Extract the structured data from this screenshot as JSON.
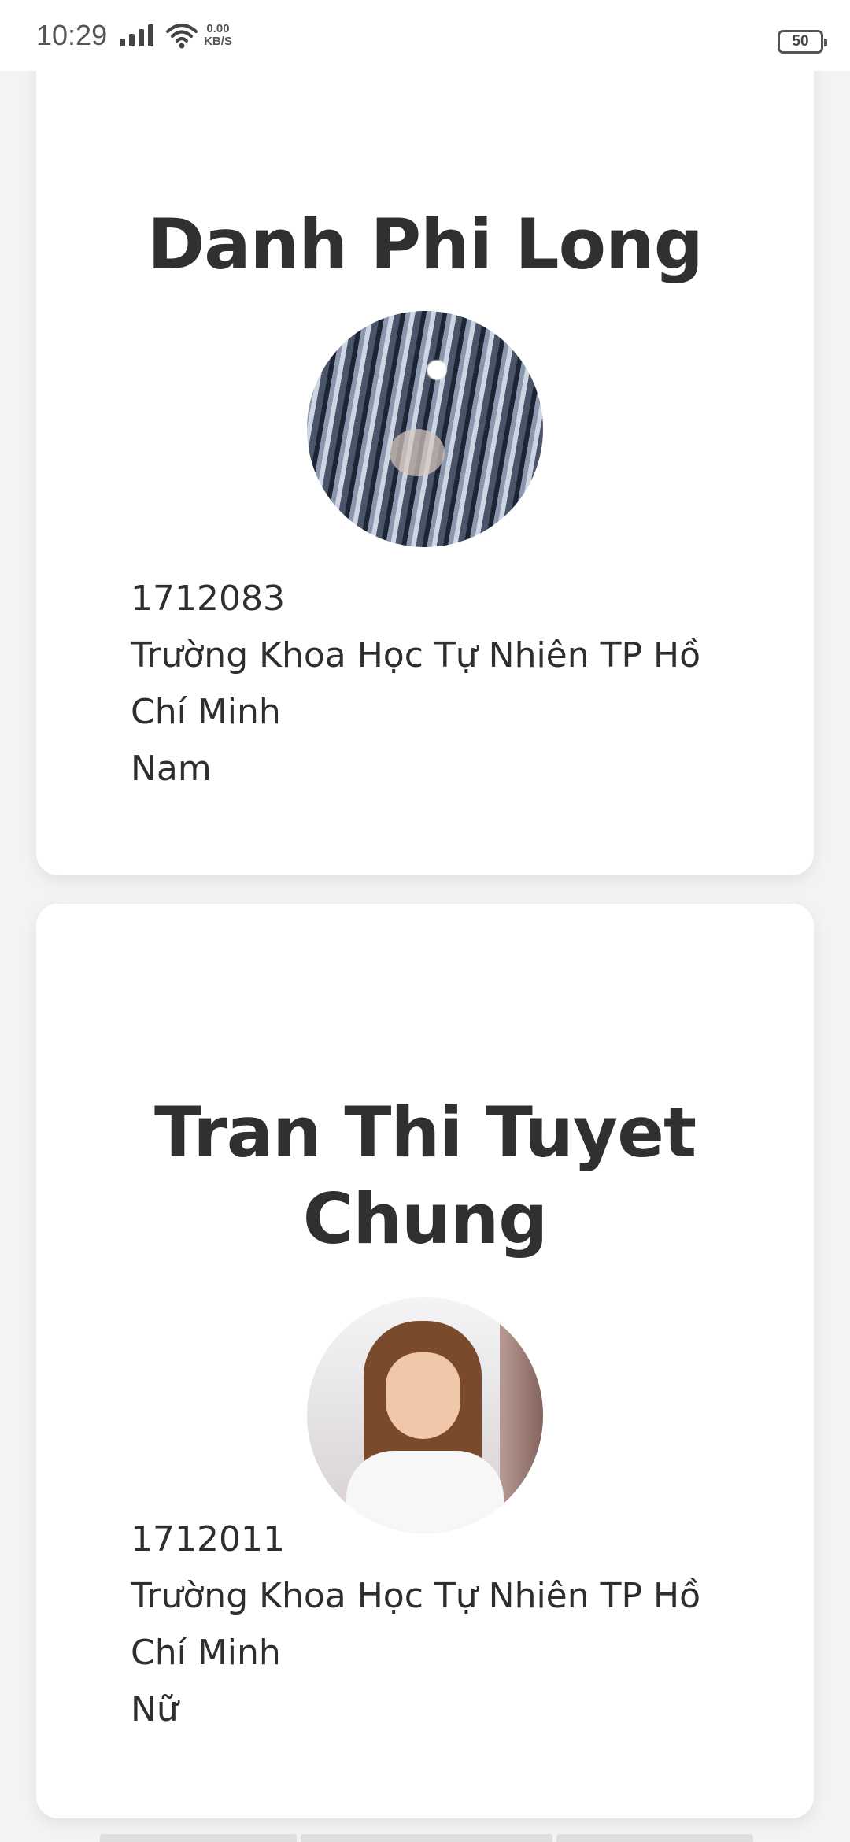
{
  "status_bar": {
    "time": "10:29",
    "net_speed_value": "0.00",
    "net_speed_unit": "KB/S",
    "battery": "50"
  },
  "profiles": [
    {
      "name": "Danh Phi Long",
      "student_id": "1712083",
      "school": "Trường Khoa Học Tự Nhiên TP Hồ Chí Minh",
      "gender": "Nam"
    },
    {
      "name": "Tran Thi Tuyet Chung",
      "student_id": "1712011",
      "school": "Trường Khoa Học Tự Nhiên TP Hồ Chí Minh",
      "gender": "Nữ"
    }
  ]
}
